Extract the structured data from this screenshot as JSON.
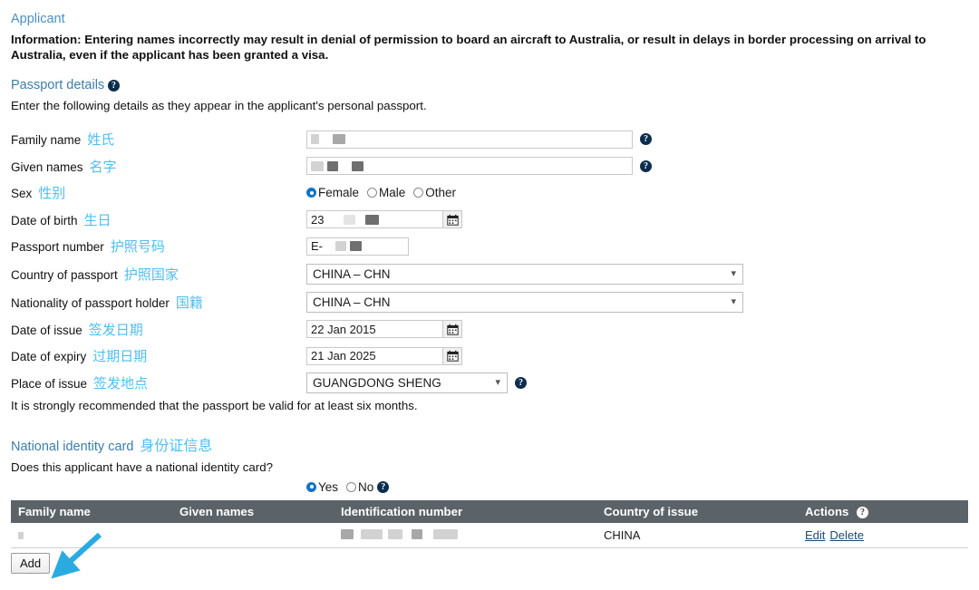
{
  "section_applicant": {
    "heading": "Applicant",
    "information": "Information: Entering names incorrectly may result in denial of permission to board an aircraft to Australia, or result in delays in border processing on arrival to Australia, even if the applicant has been granted a visa."
  },
  "passport_details": {
    "heading": "Passport details",
    "help": "?",
    "intro": "Enter the following details as they appear in the applicant's personal passport.",
    "fields": {
      "family_name": {
        "label": "Family name",
        "cn": "姓氏",
        "value": "",
        "help": "?"
      },
      "given_names": {
        "label": "Given names",
        "cn": "名字",
        "value": "",
        "help": "?"
      },
      "sex": {
        "label": "Sex",
        "cn": "性别",
        "options": [
          "Female",
          "Male",
          "Other"
        ],
        "selected": "Female"
      },
      "date_of_birth": {
        "label": "Date of birth",
        "cn": "生日",
        "value": "23",
        "icon": "calendar-icon"
      },
      "passport_number": {
        "label": "Passport number",
        "cn": "护照号码",
        "value": "E-"
      },
      "country_of_passport": {
        "label": "Country of passport",
        "cn": "护照国家",
        "value": "CHINA – CHN"
      },
      "nationality": {
        "label": "Nationality of passport holder",
        "cn": "国籍",
        "value": "CHINA – CHN"
      },
      "date_of_issue": {
        "label": "Date of issue",
        "cn": "签发日期",
        "value": "22 Jan 2015",
        "icon": "calendar-icon"
      },
      "date_of_expiry": {
        "label": "Date of expiry",
        "cn": "过期日期",
        "value": "21 Jan 2025",
        "icon": "calendar-icon"
      },
      "place_of_issue": {
        "label": "Place of issue",
        "cn": "签发地点",
        "value": "GUANGDONG SHENG",
        "help": "?"
      }
    },
    "note": "It is strongly recommended that the passport be valid for at least six months."
  },
  "national_identity_card": {
    "heading": "National identity card",
    "cn": "身份证信息",
    "question": "Does this applicant have a national identity card?",
    "answer_options": [
      "Yes",
      "No"
    ],
    "answer_selected": "Yes",
    "answer_help": "?",
    "table": {
      "columns": [
        "Family name",
        "Given names",
        "Identification number",
        "Country of issue",
        "Actions"
      ],
      "actions_help": "?",
      "rows": [
        {
          "family_name": "",
          "given_names": "",
          "identification_number": "",
          "country_of_issue": "CHINA",
          "actions": [
            "Edit",
            "Delete"
          ]
        }
      ]
    },
    "add_button": "Add"
  },
  "colors": {
    "heading_link": "#4a90c4",
    "chinese_annotation": "#4ebef2",
    "table_header_bg": "#5b6369",
    "radio_selected": "#1273c8",
    "arrow": "#29abe2",
    "table_link": "#20486e"
  }
}
